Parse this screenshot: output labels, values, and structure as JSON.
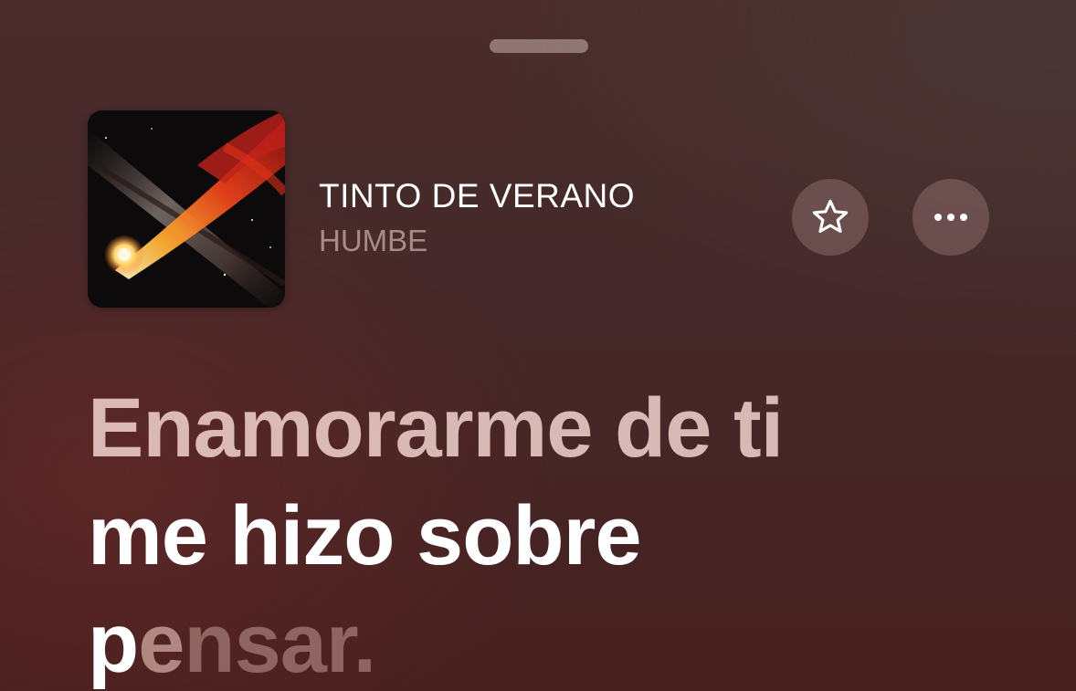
{
  "now_playing": {
    "title": "TINTO DE VERANO",
    "artist": "HUMBE"
  },
  "buttons": {
    "favorite_icon": "star-outline-icon",
    "more_icon": "ellipsis-icon"
  },
  "lyrics": {
    "line_1": "Enamorarme de ti",
    "line_2": "me hizo sobre",
    "line_3_sung": "p",
    "line_3_partial": "e",
    "line_3_upcoming": "nsar."
  },
  "colors": {
    "background": "#47201f",
    "text_primary": "#ffffff",
    "text_secondary": "#b89a96"
  }
}
